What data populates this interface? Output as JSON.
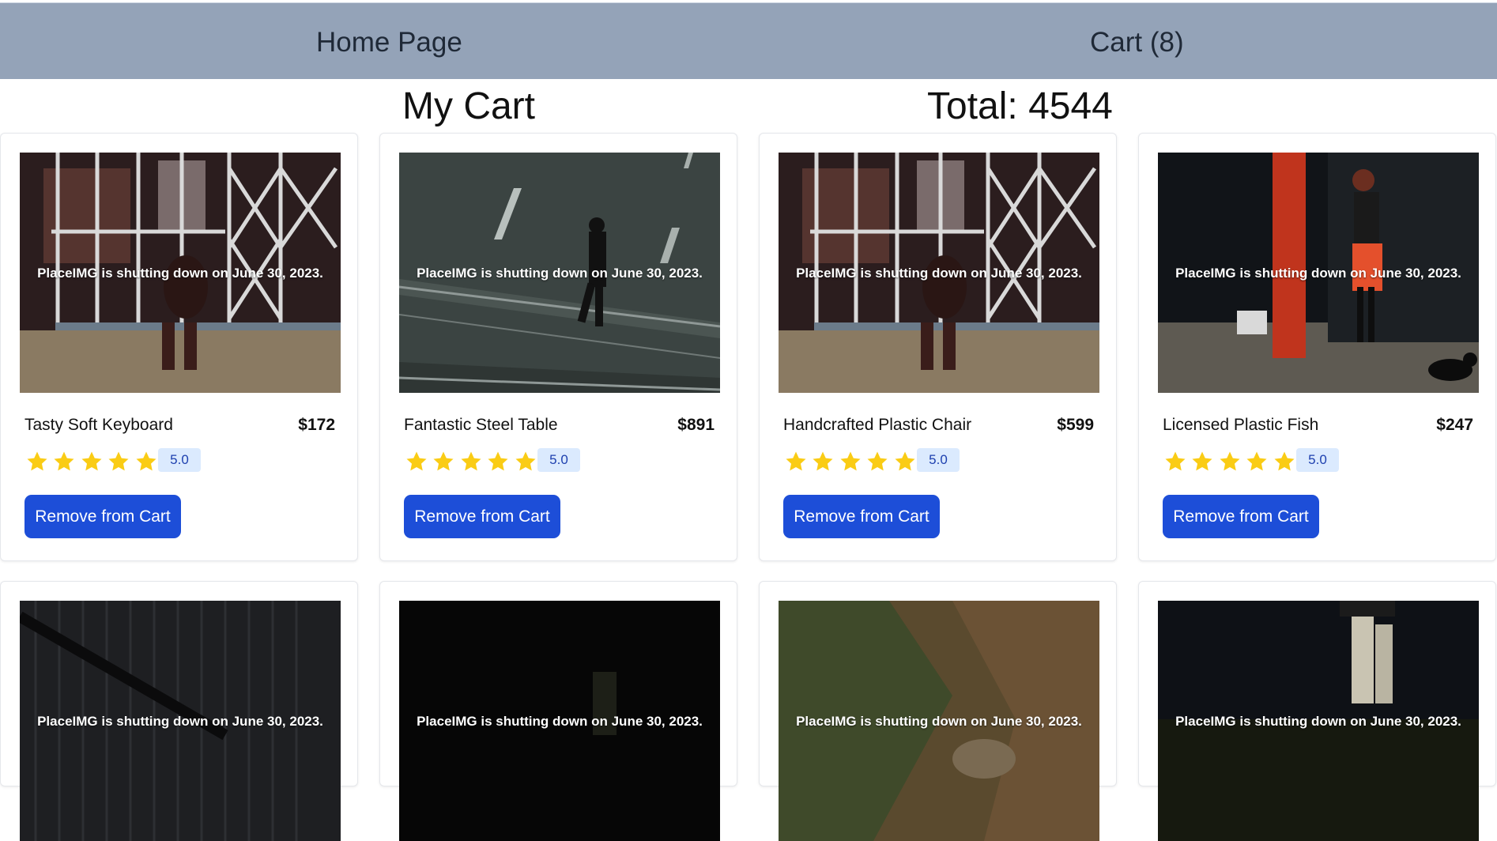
{
  "nav": {
    "home_label": "Home Page",
    "cart_label": "Cart (8)"
  },
  "heading": {
    "title": "My Cart",
    "total": "Total: 4544"
  },
  "image_caption": "PlaceIMG is shutting down on June 30, 2023.",
  "button_label": "Remove from Cart",
  "colors": {
    "topbar": "#94a3b8",
    "button": "#1d4ed8",
    "star": "#facc15",
    "badge_bg": "#dbeafe"
  },
  "products": [
    {
      "name": "Tasty Soft Keyboard",
      "price": "$172",
      "rating": "5.0",
      "stars": 5
    },
    {
      "name": "Fantastic Steel Table",
      "price": "$891",
      "rating": "5.0",
      "stars": 5
    },
    {
      "name": "Handcrafted Plastic Chair",
      "price": "$599",
      "rating": "5.0",
      "stars": 5
    },
    {
      "name": "Licensed Plastic Fish",
      "price": "$247",
      "rating": "5.0",
      "stars": 5
    },
    {
      "caption": "PlaceIMG is shutting down on June 30, 2023."
    },
    {
      "caption": "PlaceIMG is shutting down on June 30, 2023."
    },
    {
      "caption": "PlaceIMG is shutting down on June 30, 2023."
    },
    {
      "caption": "PlaceIMG is shutting down on June 30, 2023."
    }
  ]
}
